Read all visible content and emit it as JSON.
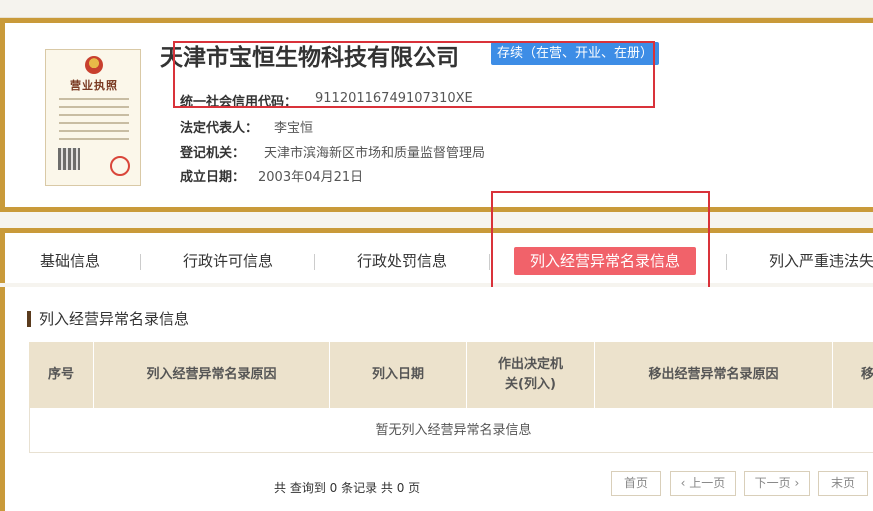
{
  "company": {
    "license_title": "营业执照",
    "name": "天津市宝恒生物科技有限公司",
    "status": "存续（在营、开业、在册）",
    "credit_code_label": "统一社会信用代码：",
    "credit_code": "91120116749107310XE",
    "legal_rep_label": "法定代表人：",
    "legal_rep": "李宝恒",
    "authority_label": "登记机关：",
    "authority": "天津市滨海新区市场和质量监督管理局",
    "founded_label": "成立日期：",
    "founded": "2003年04月21日"
  },
  "tabs": [
    {
      "label": "基础信息"
    },
    {
      "label": "行政许可信息"
    },
    {
      "label": "行政处罚信息"
    },
    {
      "label": "列入经营异常名录信息"
    },
    {
      "label": "列入严重违法失信"
    }
  ],
  "section": {
    "title": "列入经营异常名录信息"
  },
  "table": {
    "columns": [
      "序号",
      "列入经营异常名录原因",
      "列入日期",
      "作出决定机关(列入)",
      "移出经营异常名录原因",
      "移"
    ],
    "empty_text": "暂无列入经营异常名录信息"
  },
  "pager": {
    "summary": "共 查询到 0 条记录 共 0 页",
    "first": "首页",
    "prev": "上一页",
    "next": "下一页",
    "last": "末页"
  },
  "colors": {
    "accent_border": "#c99a3a",
    "active_tab": "#f1626a",
    "status_badge": "#3d8de6",
    "annotation_box": "#d9323a"
  }
}
